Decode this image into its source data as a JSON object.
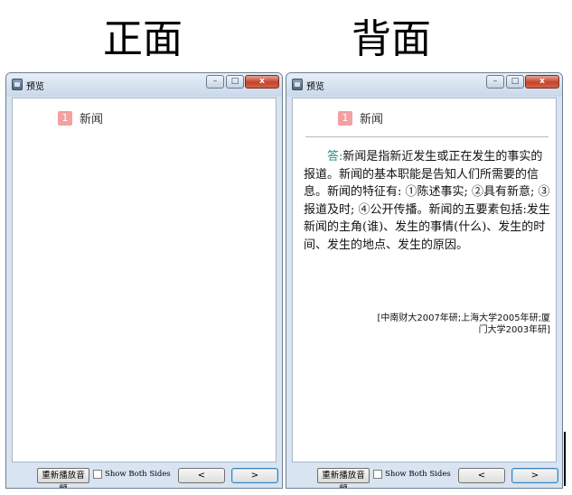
{
  "headings": {
    "front": "正面",
    "back": "背面"
  },
  "window": {
    "title": "预览",
    "min_glyph": "–",
    "max_glyph": "□",
    "close_glyph": "x"
  },
  "card": {
    "number": "1",
    "title": "新闻",
    "answer_label": "答:",
    "answer_text": "新闻是指新近发生或正在发生的事实的报道。新闻的基本职能是告知人们所需要的信息。新闻的特征有: ①陈述事实; ②具有新意; ③报道及时; ④公开传播。新闻的五要素包括:发生新闻的主角(谁)、发生的事情(什么)、发生的时间、发生的地点、发生的原因。",
    "source": "[中南财大2007年研;上海大学2005年研;厦门大学2003年研]"
  },
  "controls": {
    "replay_label": "重新播放音频",
    "both_sides_label": "Show Both Sides",
    "both_sides_checked": false,
    "prev_label": "<",
    "next_label": ">"
  }
}
